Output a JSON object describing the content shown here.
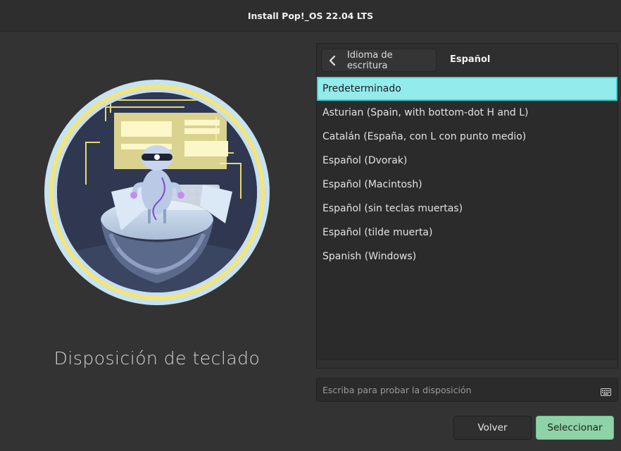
{
  "window": {
    "title": "Install Pop!_OS 22.04 LTS"
  },
  "illustration": {
    "icon": "robot-keyboard-illustration",
    "colors": {
      "ring": "#f2e57a",
      "outer": "#c6e3f2",
      "bg": "#2b3349"
    }
  },
  "page": {
    "title": "Disposición de teclado"
  },
  "breadcrumb": {
    "back_label": "Idioma de escritura",
    "current": "Español"
  },
  "layouts": {
    "selected_index": 0,
    "items": [
      {
        "label": "Predeterminado"
      },
      {
        "label": "Asturian (Spain, with bottom-dot H and L)"
      },
      {
        "label": "Catalán (España, con L con punto medio)"
      },
      {
        "label": "Español (Dvorak)"
      },
      {
        "label": "Español (Macintosh)"
      },
      {
        "label": "Español (sin teclas muertas)"
      },
      {
        "label": "Español (tilde muerta)"
      },
      {
        "label": "Spanish (Windows)"
      }
    ]
  },
  "test_input": {
    "placeholder": "Escriba para probar la disposición",
    "value": "",
    "icon": "keyboard-icon"
  },
  "actions": {
    "back_label": "Volver",
    "select_label": "Seleccionar"
  },
  "colors": {
    "selection": "#94ebeb",
    "selection_border": "#3ed2d2",
    "primary": "#8ed3a7"
  }
}
